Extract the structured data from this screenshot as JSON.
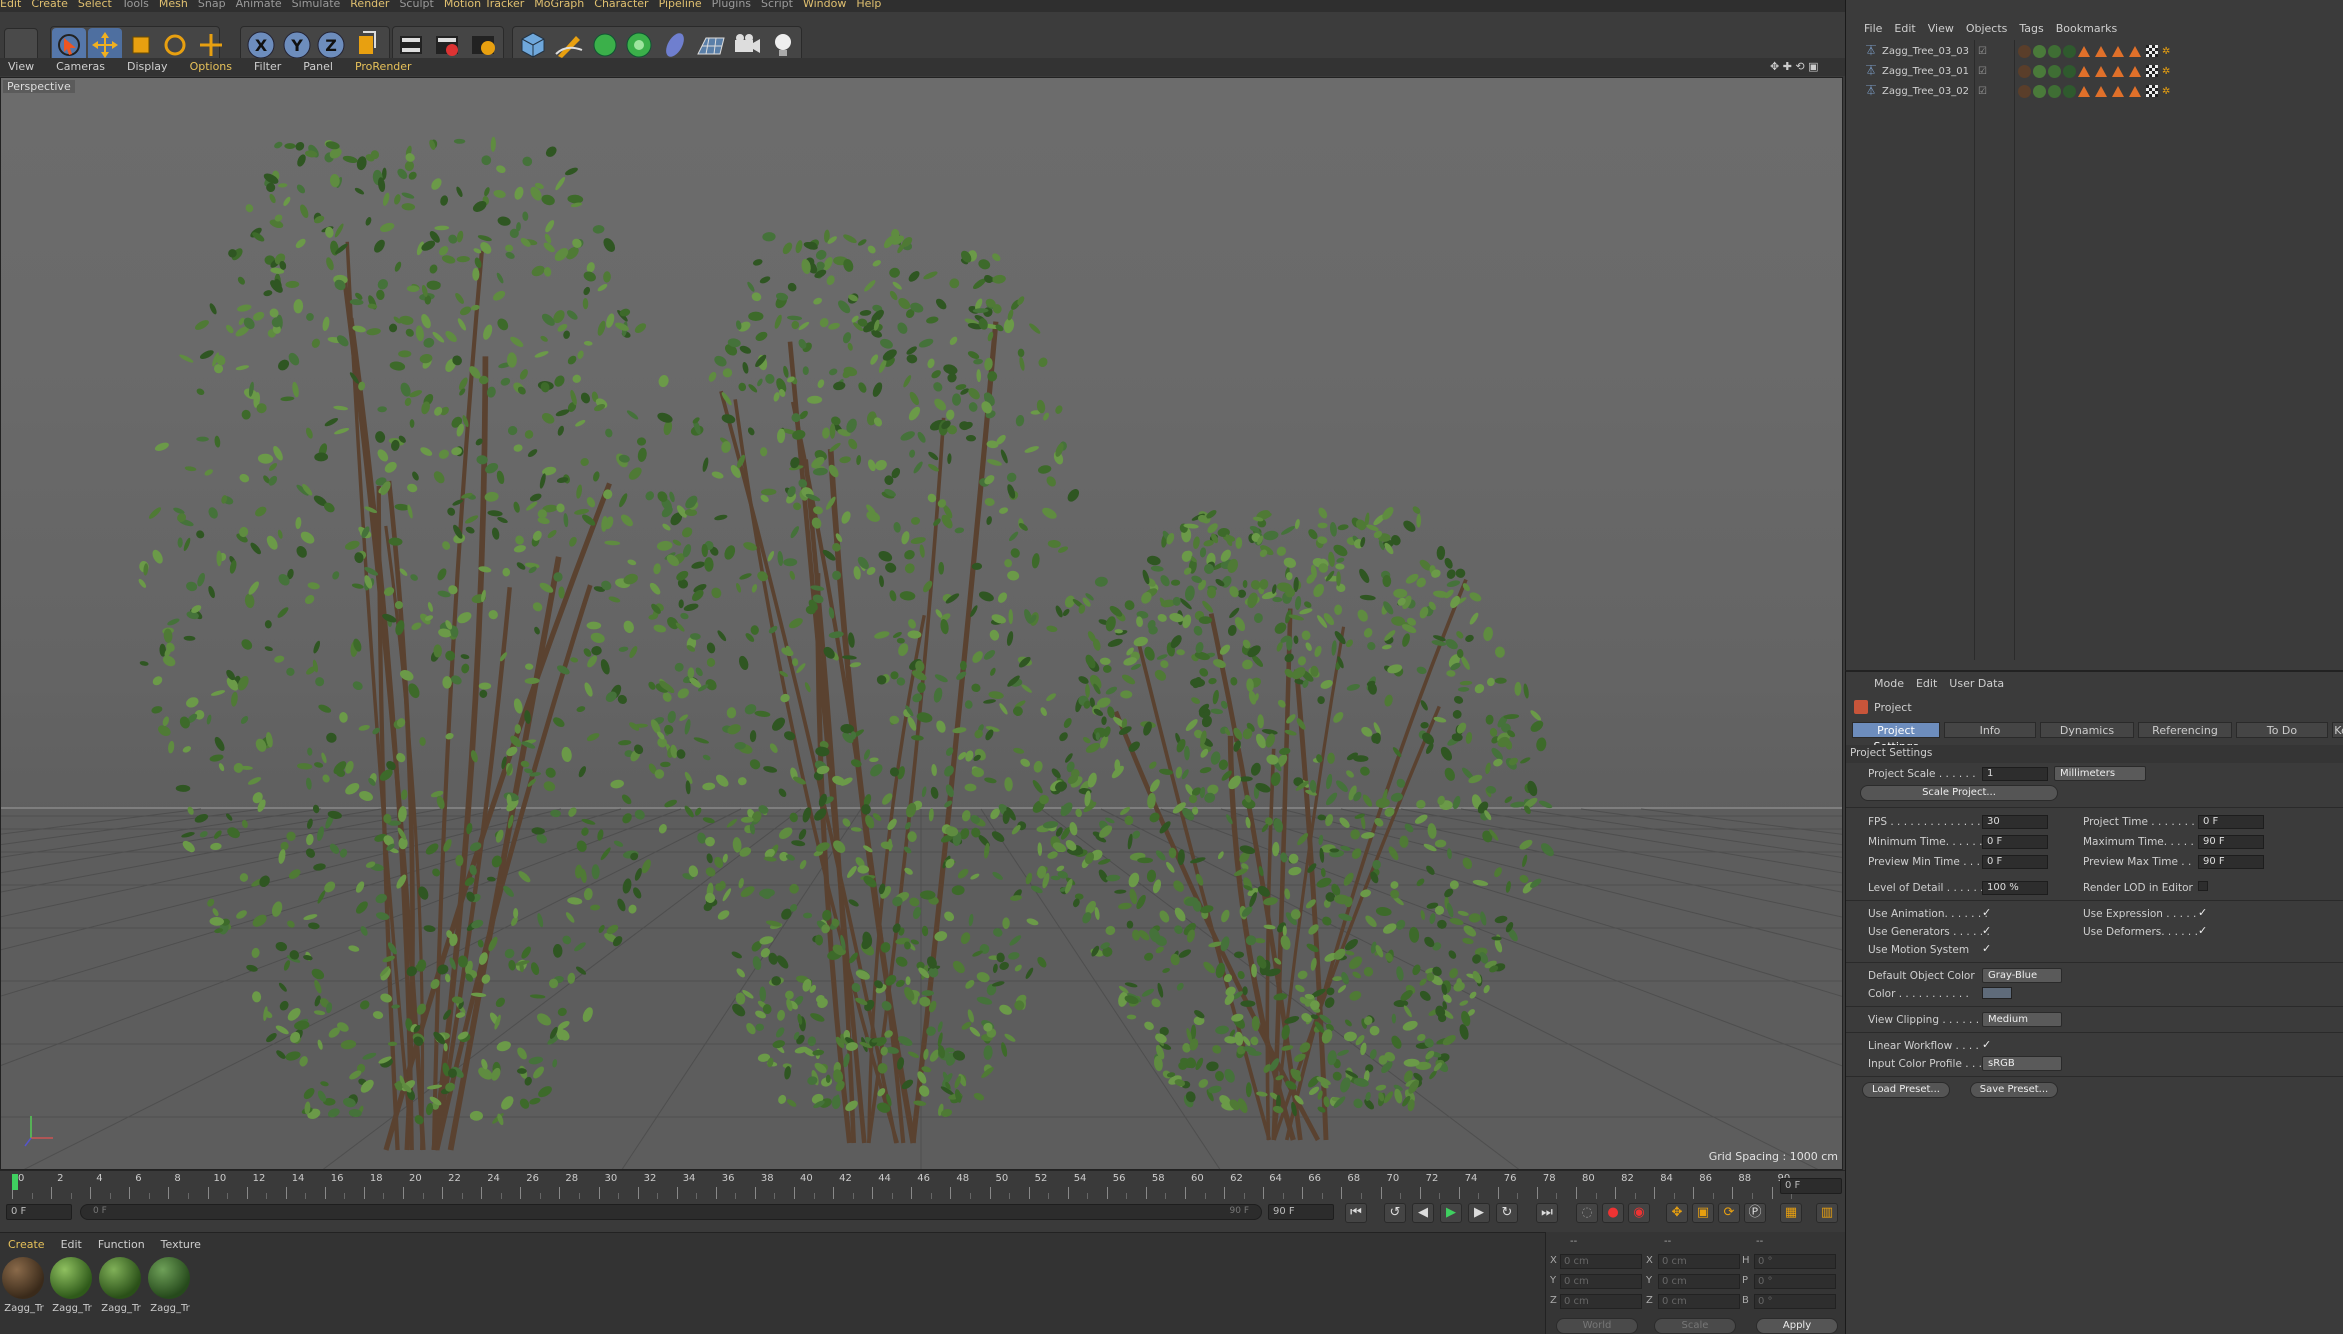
{
  "menubar": [
    "Edit",
    "Create",
    "Select",
    "Tools",
    "Mesh",
    "Snap",
    "Animate",
    "Simulate",
    "Render",
    "Sculpt",
    "Motion Tracker",
    "MoGraph",
    "Character",
    "Pipeline",
    "Plugins",
    "Script",
    "Window",
    "Help"
  ],
  "viewport_menu": [
    "View",
    "Cameras",
    "Display",
    "Options",
    "Filter",
    "Panel",
    "ProRender"
  ],
  "viewport": {
    "label": "Perspective",
    "grid_spacing": "Grid Spacing : 1000 cm"
  },
  "timeline": {
    "ticks": [
      "0",
      "2",
      "4",
      "6",
      "8",
      "10",
      "12",
      "14",
      "16",
      "18",
      "20",
      "22",
      "24",
      "26",
      "28",
      "30",
      "32",
      "34",
      "36",
      "38",
      "40",
      "42",
      "44",
      "46",
      "48",
      "50",
      "52",
      "54",
      "56",
      "58",
      "60",
      "62",
      "64",
      "66",
      "68",
      "70",
      "72",
      "74",
      "76",
      "78",
      "80",
      "82",
      "84",
      "86",
      "88",
      "90"
    ],
    "current_frame": "0 F",
    "start_field": "0 F",
    "range_start": "0 F",
    "range_end": "90 F",
    "end_field": "90 F"
  },
  "materials": {
    "menu": [
      "Create",
      "Edit",
      "Function",
      "Texture"
    ],
    "items": [
      "Zagg_Tr",
      "Zagg_Tr",
      "Zagg_Tr",
      "Zagg_Tr"
    ]
  },
  "coords": {
    "header": [
      "--",
      "--",
      "--"
    ],
    "rows": [
      {
        "a": "X",
        "av": "0 cm",
        "b": "X",
        "bv": "0 cm",
        "c": "H",
        "cv": "0 °"
      },
      {
        "a": "Y",
        "av": "0 cm",
        "b": "Y",
        "bv": "0 cm",
        "c": "P",
        "cv": "0 °"
      },
      {
        "a": "Z",
        "av": "0 cm",
        "b": "Z",
        "bv": "0 cm",
        "c": "B",
        "cv": "0 °"
      }
    ],
    "world": "World",
    "scale": "Scale",
    "apply": "Apply"
  },
  "objects": {
    "menu": [
      "File",
      "Edit",
      "View",
      "Objects",
      "Tags",
      "Bookmarks"
    ],
    "items": [
      "Zagg_Tree_03_03",
      "Zagg_Tree_03_01",
      "Zagg_Tree_03_02"
    ]
  },
  "attributes": {
    "menu": [
      "Mode",
      "Edit",
      "User Data"
    ],
    "title": "Project",
    "tabs": [
      "Project Settings",
      "Info",
      "Dynamics",
      "Referencing",
      "To Do",
      "Ke"
    ],
    "section": "Project Settings",
    "project_scale_label": "Project Scale . . . . . .",
    "project_scale_value": "1",
    "project_scale_unit": "Millimeters",
    "scale_project_button": "Scale Project...",
    "fps_label": "FPS . . . . . . . . . . . . . . .",
    "fps_value": "30",
    "project_time_label": "Project Time . . . . . . .",
    "project_time_value": "0 F",
    "min_time_label": "Minimum Time. . . . . . .",
    "min_time_value": "0 F",
    "max_time_label": "Maximum Time. . . . . .",
    "max_time_value": "90 F",
    "prev_min_label": "Preview Min Time . . .",
    "prev_min_value": "0 F",
    "prev_max_label": "Preview Max Time . .",
    "prev_max_value": "90 F",
    "lod_label": "Level of Detail . . . . . .",
    "lod_value": "100 %",
    "render_lod_label": "Render LOD in Editor",
    "use_anim_label": "Use Animation. . . . . . .",
    "use_expr_label": "Use Expression . . . . .",
    "use_gen_label": "Use Generators . . . . . .",
    "use_def_label": "Use Deformers. . . . . .",
    "use_motion_label": "Use Motion System",
    "check": "✓",
    "def_color_label": "Default Object Color",
    "def_color_value": "Gray-Blue",
    "color_label": "Color . . . . . . . . . . .",
    "view_clip_label": "View Clipping . . . . . .",
    "view_clip_value": "Medium",
    "linear_label": "Linear Workflow . . . .",
    "input_profile_label": "Input Color Profile . . .",
    "input_profile_value": "sRGB",
    "load_preset": "Load Preset...",
    "save_preset": "Save Preset...",
    "swatch_color": "#5f6b7a"
  },
  "colors": {
    "accent": "#e6c15a",
    "tab_active": "#6d8dbd",
    "leaf": "#4f7a35",
    "trunk": "#5a4230"
  }
}
